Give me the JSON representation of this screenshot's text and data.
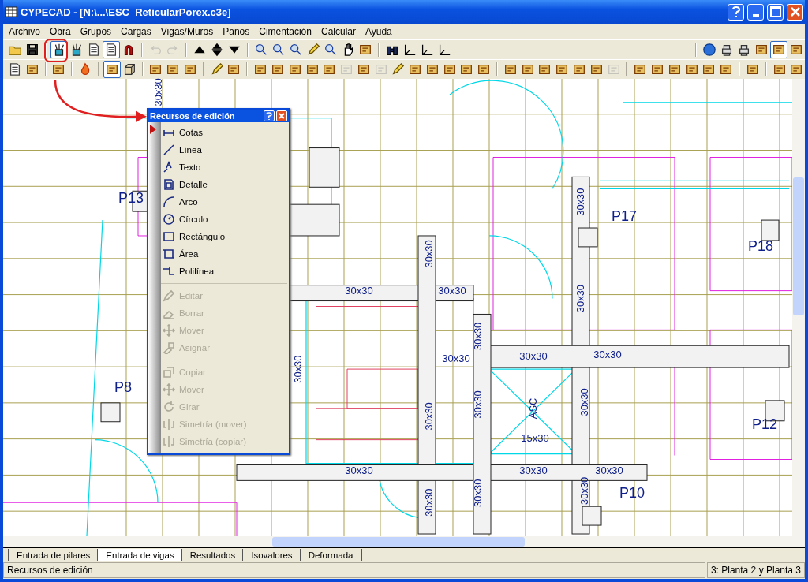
{
  "window": {
    "title": "CYPECAD - [N:\\...\\ESC_ReticularPorex.c3e]"
  },
  "menu": [
    "Archivo",
    "Obra",
    "Grupos",
    "Cargas",
    "Vigas/Muros",
    "Paños",
    "Cimentación",
    "Calcular",
    "Ayuda"
  ],
  "toolbars": [
    {
      "groups": [
        {
          "buttons": [
            {
              "kind": "folder",
              "pressed": false,
              "disabled": false
            },
            {
              "kind": "save",
              "pressed": false,
              "disabled": false
            }
          ]
        },
        {
          "buttons": [
            {
              "kind": "pencils",
              "pressed": true,
              "disabled": false
            },
            {
              "kind": "pencils",
              "pressed": false,
              "disabled": false
            },
            {
              "kind": "document",
              "pressed": false,
              "disabled": false
            },
            {
              "kind": "document",
              "pressed": true,
              "disabled": false
            },
            {
              "kind": "magnet",
              "pressed": false,
              "disabled": false
            }
          ]
        },
        {
          "buttons": [
            {
              "kind": "undo",
              "pressed": false,
              "disabled": true
            },
            {
              "kind": "redo",
              "pressed": false,
              "disabled": true
            }
          ]
        },
        {
          "buttons": [
            {
              "kind": "up",
              "pressed": false,
              "disabled": false
            },
            {
              "kind": "updown",
              "pressed": false,
              "disabled": false
            },
            {
              "kind": "down",
              "pressed": false,
              "disabled": false
            }
          ]
        },
        {
          "buttons": [
            {
              "kind": "zoom",
              "pressed": false,
              "disabled": false
            },
            {
              "kind": "zoom",
              "pressed": false,
              "disabled": false
            },
            {
              "kind": "zoom",
              "pressed": false,
              "disabled": false
            },
            {
              "kind": "pencil",
              "pressed": false,
              "disabled": false
            },
            {
              "kind": "zoom",
              "pressed": false,
              "disabled": false
            },
            {
              "kind": "hand",
              "pressed": false,
              "disabled": false
            },
            {
              "kind": "tool",
              "pressed": false,
              "disabled": false
            }
          ]
        },
        {
          "buttons": [
            {
              "kind": "binoculars",
              "pressed": false,
              "disabled": false
            },
            {
              "kind": "axes",
              "pressed": false,
              "disabled": false
            },
            {
              "kind": "axes",
              "pressed": false,
              "disabled": false
            },
            {
              "kind": "axes",
              "pressed": false,
              "disabled": false
            }
          ]
        }
      ],
      "right_groups": [
        {
          "buttons": [
            {
              "kind": "globe",
              "pressed": false,
              "disabled": false
            },
            {
              "kind": "printer",
              "pressed": false,
              "disabled": false
            },
            {
              "kind": "printer",
              "pressed": false,
              "disabled": false
            },
            {
              "kind": "tool",
              "pressed": false,
              "disabled": false
            },
            {
              "kind": "tool",
              "pressed": true,
              "disabled": false
            },
            {
              "kind": "tool",
              "pressed": false,
              "disabled": false
            }
          ]
        }
      ]
    },
    {
      "groups": [
        {
          "buttons": [
            {
              "kind": "document",
              "pressed": false,
              "disabled": false
            },
            {
              "kind": "tool",
              "pressed": false,
              "disabled": false
            }
          ]
        },
        {
          "buttons": [
            {
              "kind": "tool",
              "pressed": false,
              "disabled": false
            }
          ]
        },
        {
          "buttons": [
            {
              "kind": "flame",
              "pressed": false,
              "disabled": false
            }
          ]
        },
        {
          "buttons": [
            {
              "kind": "tool",
              "pressed": true,
              "disabled": false
            },
            {
              "kind": "cube",
              "pressed": false,
              "disabled": false
            }
          ]
        },
        {
          "buttons": [
            {
              "kind": "tool",
              "pressed": false,
              "disabled": false
            },
            {
              "kind": "tool",
              "pressed": false,
              "disabled": false
            },
            {
              "kind": "tool",
              "pressed": false,
              "disabled": false
            }
          ]
        },
        {
          "buttons": [
            {
              "kind": "pencil",
              "pressed": false,
              "disabled": false
            },
            {
              "kind": "tool",
              "pressed": false,
              "disabled": false
            }
          ]
        },
        {
          "buttons": [
            {
              "kind": "tool",
              "pressed": false,
              "disabled": false
            },
            {
              "kind": "tool",
              "pressed": false,
              "disabled": false
            },
            {
              "kind": "tool",
              "pressed": false,
              "disabled": false
            },
            {
              "kind": "tool",
              "pressed": false,
              "disabled": false
            },
            {
              "kind": "tool",
              "pressed": false,
              "disabled": false
            },
            {
              "kind": "tool",
              "pressed": false,
              "disabled": true
            },
            {
              "kind": "tool",
              "pressed": false,
              "disabled": false
            },
            {
              "kind": "tool",
              "pressed": false,
              "disabled": true
            },
            {
              "kind": "pencil",
              "pressed": false,
              "disabled": false
            },
            {
              "kind": "tool",
              "pressed": false,
              "disabled": false
            },
            {
              "kind": "tool",
              "pressed": false,
              "disabled": false
            },
            {
              "kind": "tool",
              "pressed": false,
              "disabled": false
            },
            {
              "kind": "tool",
              "pressed": false,
              "disabled": false
            },
            {
              "kind": "tool",
              "pressed": false,
              "disabled": false
            }
          ]
        },
        {
          "buttons": [
            {
              "kind": "tool",
              "pressed": false,
              "disabled": false
            },
            {
              "kind": "tool",
              "pressed": false,
              "disabled": false
            },
            {
              "kind": "tool",
              "pressed": false,
              "disabled": false
            },
            {
              "kind": "tool",
              "pressed": false,
              "disabled": false
            },
            {
              "kind": "tool",
              "pressed": false,
              "disabled": false
            },
            {
              "kind": "tool",
              "pressed": false,
              "disabled": false
            },
            {
              "kind": "tool",
              "pressed": false,
              "disabled": true
            }
          ]
        },
        {
          "buttons": [
            {
              "kind": "tool",
              "pressed": false,
              "disabled": false
            },
            {
              "kind": "tool",
              "pressed": false,
              "disabled": false
            },
            {
              "kind": "tool",
              "pressed": false,
              "disabled": false
            },
            {
              "kind": "tool",
              "pressed": false,
              "disabled": false
            },
            {
              "kind": "tool",
              "pressed": false,
              "disabled": false
            },
            {
              "kind": "tool",
              "pressed": false,
              "disabled": false
            }
          ]
        },
        {
          "buttons": [
            {
              "kind": "tool",
              "pressed": false,
              "disabled": false
            }
          ]
        },
        {
          "buttons": [
            {
              "kind": "tool",
              "pressed": false,
              "disabled": false
            },
            {
              "kind": "tool",
              "pressed": false,
              "disabled": false
            }
          ]
        }
      ]
    }
  ],
  "plan": {
    "column_labels": [
      "P13",
      "P17",
      "P18",
      "P8",
      "P12",
      "P10"
    ],
    "section_labels": [
      "30x30",
      "30x30",
      "30x30",
      "30x30",
      "30x30",
      "30x30",
      "30x30",
      "30x30",
      "30x30",
      "30x30",
      "30x30",
      "30x30",
      "30x30",
      "30x30",
      "30x30",
      "30x30",
      "30x30",
      "30x30",
      "30x30",
      "30x30",
      "15x30",
      "ASC"
    ]
  },
  "panel": {
    "title": "Recursos de edición",
    "groups": [
      [
        {
          "kind": "dimension",
          "label": "Cotas",
          "selected": true,
          "disabled": false
        },
        {
          "kind": "line",
          "label": "Línea",
          "selected": false,
          "disabled": false
        },
        {
          "kind": "text",
          "label": "Texto",
          "selected": false,
          "disabled": false
        },
        {
          "kind": "detail",
          "label": "Detalle",
          "selected": false,
          "disabled": false
        },
        {
          "kind": "arc",
          "label": "Arco",
          "selected": false,
          "disabled": false
        },
        {
          "kind": "circle",
          "label": "Círculo",
          "selected": false,
          "disabled": false
        },
        {
          "kind": "rectangle",
          "label": "Rectángulo",
          "selected": false,
          "disabled": false
        },
        {
          "kind": "area",
          "label": "Área",
          "selected": false,
          "disabled": false
        },
        {
          "kind": "polyline",
          "label": "Polilínea",
          "selected": false,
          "disabled": false
        }
      ],
      [
        {
          "kind": "edit",
          "label": "Editar",
          "selected": false,
          "disabled": true
        },
        {
          "kind": "erase",
          "label": "Borrar",
          "selected": false,
          "disabled": true
        },
        {
          "kind": "move",
          "label": "Mover",
          "selected": false,
          "disabled": true
        },
        {
          "kind": "assign",
          "label": "Asignar",
          "selected": false,
          "disabled": true
        }
      ],
      [
        {
          "kind": "copy",
          "label": "Copiar",
          "selected": false,
          "disabled": true
        },
        {
          "kind": "move",
          "label": "Mover",
          "selected": false,
          "disabled": true
        },
        {
          "kind": "rotate",
          "label": "Girar",
          "selected": false,
          "disabled": true
        },
        {
          "kind": "mirror",
          "label": "Simetría (mover)",
          "selected": false,
          "disabled": true
        },
        {
          "kind": "mirror",
          "label": "Simetría (copiar)",
          "selected": false,
          "disabled": true
        }
      ]
    ]
  },
  "tabs": [
    {
      "label": "Entrada de pilares",
      "selected": false
    },
    {
      "label": "Entrada de vigas",
      "selected": true
    },
    {
      "label": "Resultados",
      "selected": false
    },
    {
      "label": "Isovalores",
      "selected": false
    },
    {
      "label": "Deformada",
      "selected": false
    }
  ],
  "status_bar": {
    "message": "Recursos de edición",
    "floor": "3: Planta 2 y Planta 3"
  }
}
